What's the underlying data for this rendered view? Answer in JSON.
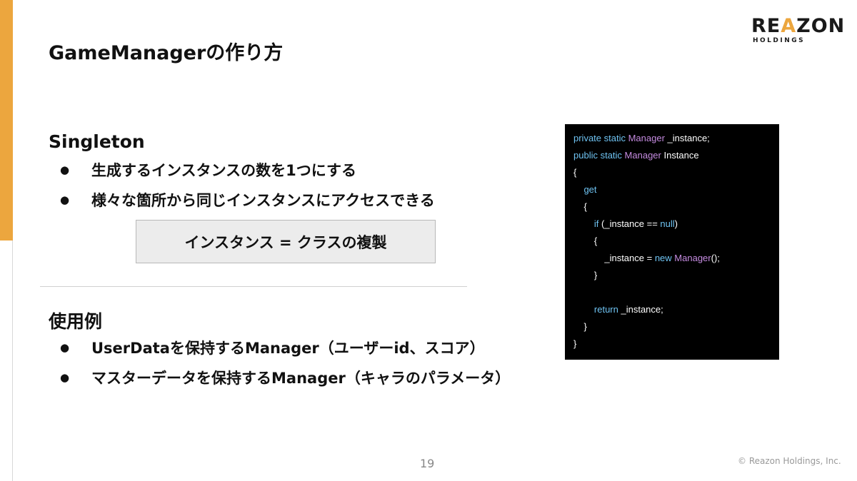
{
  "slide": {
    "title": "GameManagerの作り方",
    "page_number": "19",
    "copyright": "© Reazon Holdings, Inc."
  },
  "logo": {
    "main_left": "RE",
    "main_a": "A",
    "main_right": "ZON",
    "sub": "HOLDINGS"
  },
  "colors": {
    "accent": "#ECA63E",
    "code_keyword": "#6FC3F2",
    "code_type": "#C58BE0",
    "code_text": "#FFFFFF"
  },
  "singleton": {
    "heading": "Singleton",
    "bullets": [
      "生成するインスタンスの数を1つにする",
      "様々な箇所から同じインスタンスにアクセスできる"
    ],
    "box_text": "インスタンス = クラスの複製"
  },
  "usage": {
    "heading": "使用例",
    "bullets": [
      "UserDataを保持するManager（ユーザーid、スコア）",
      "マスターデータを保持するManager（キャラのパラメータ）"
    ]
  },
  "bullet_marker": "●",
  "code": {
    "lines": [
      [
        {
          "t": "private static ",
          "c": "k"
        },
        {
          "t": "Manager",
          "c": "t"
        },
        {
          "t": " _instance;",
          "c": "n"
        }
      ],
      [
        {
          "t": "public static ",
          "c": "k"
        },
        {
          "t": "Manager",
          "c": "t"
        },
        {
          "t": " Instance",
          "c": "n"
        }
      ],
      [
        {
          "t": "{",
          "c": "n"
        }
      ],
      [
        {
          "t": "    ",
          "c": "n"
        },
        {
          "t": "get",
          "c": "k"
        }
      ],
      [
        {
          "t": "    {",
          "c": "n"
        }
      ],
      [
        {
          "t": "        ",
          "c": "n"
        },
        {
          "t": "if",
          "c": "k"
        },
        {
          "t": " (_instance == ",
          "c": "n"
        },
        {
          "t": "null",
          "c": "k"
        },
        {
          "t": ")",
          "c": "n"
        }
      ],
      [
        {
          "t": "        {",
          "c": "n"
        }
      ],
      [
        {
          "t": "            _instance = ",
          "c": "n"
        },
        {
          "t": "new",
          "c": "k"
        },
        {
          "t": " ",
          "c": "n"
        },
        {
          "t": "Manager",
          "c": "t"
        },
        {
          "t": "();",
          "c": "n"
        }
      ],
      [
        {
          "t": "        }",
          "c": "n"
        }
      ],
      [
        {
          "t": "",
          "c": "n"
        }
      ],
      [
        {
          "t": "        ",
          "c": "n"
        },
        {
          "t": "return",
          "c": "k"
        },
        {
          "t": " _instance;",
          "c": "n"
        }
      ],
      [
        {
          "t": "    }",
          "c": "n"
        }
      ],
      [
        {
          "t": "}",
          "c": "n"
        }
      ]
    ]
  }
}
